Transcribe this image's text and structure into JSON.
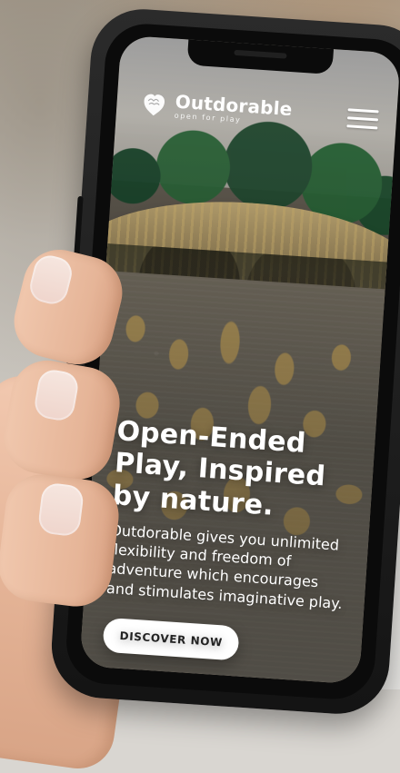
{
  "site": {
    "brand_name": "Outdorable",
    "brand_tagline": "open for play"
  },
  "header": {
    "menu_icon": "hamburger-menu-icon",
    "logo_icon": "heart-cloud-icon"
  },
  "hero": {
    "title": "Open-Ended Play, Inspired by nature.",
    "body": "Outdorable gives you unlimited flexibility and freedom of adventure which encourages and stimulates imaginative play.",
    "cta_label": "DISCOVER NOW"
  },
  "colors": {
    "text_on_image": "#ffffff",
    "cta_bg": "#ffffff",
    "cta_text": "#222222"
  }
}
